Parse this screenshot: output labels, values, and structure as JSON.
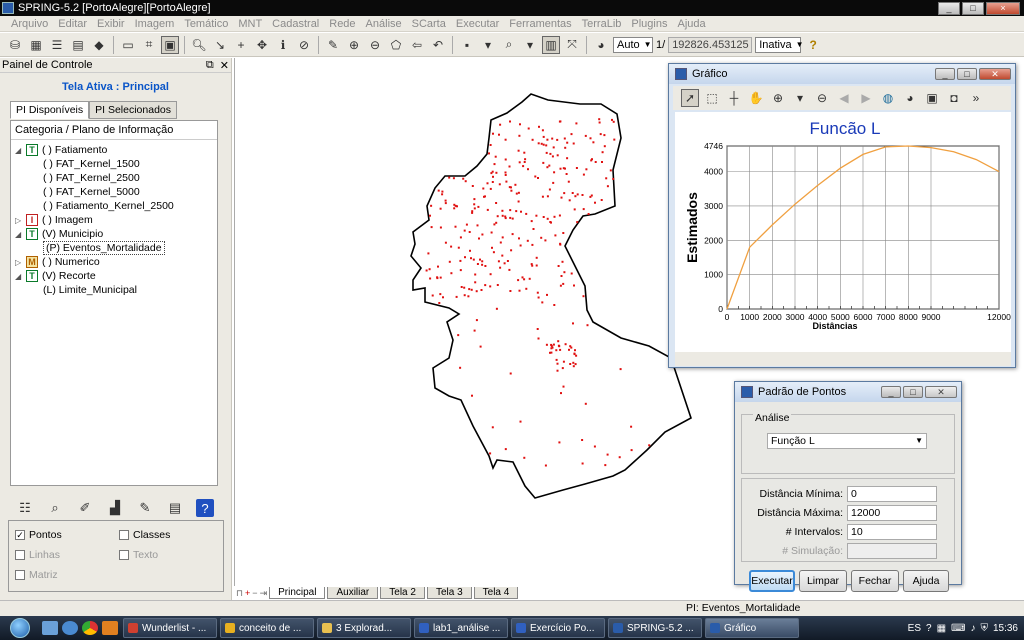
{
  "app": {
    "title": "SPRING-5.2 [PortoAlegre][PortoAlegre]",
    "window_buttons": [
      "_",
      "□",
      "×"
    ]
  },
  "menu": [
    {
      "label": "Arquivo",
      "enabled": false
    },
    {
      "label": "Editar",
      "enabled": false
    },
    {
      "label": "Exibir",
      "enabled": false
    },
    {
      "label": "Imagem",
      "enabled": false
    },
    {
      "label": "Temático",
      "enabled": false
    },
    {
      "label": "MNT",
      "enabled": false
    },
    {
      "label": "Cadastral",
      "enabled": false
    },
    {
      "label": "Rede",
      "enabled": false
    },
    {
      "label": "Análise",
      "enabled": false
    },
    {
      "label": "SCarta",
      "enabled": false
    },
    {
      "label": "Executar",
      "enabled": false
    },
    {
      "label": "Ferramentas",
      "enabled": false
    },
    {
      "label": "TerraLib",
      "enabled": false
    },
    {
      "label": "Plugins",
      "enabled": false
    },
    {
      "label": "Ajuda",
      "enabled": false
    }
  ],
  "toolbar": {
    "zoom_mode": "Auto",
    "scale_prefix": "1/",
    "scale_value": "192826.453125",
    "status_mode": "Inativa",
    "help_icon": "?"
  },
  "control_panel": {
    "title": "Painel de Controle",
    "active_screen": "Tela Ativa : Principal",
    "tabs": [
      "PI Disponíveis",
      "PI Selecionados"
    ],
    "tree_header": "Categoria / Plano de Informação",
    "tree": [
      {
        "expander": "◢",
        "badge": "T",
        "label": "( ) Fatiamento",
        "indent": 0
      },
      {
        "expander": "",
        "badge": "",
        "label": "( ) FAT_Kernel_1500",
        "indent": 1
      },
      {
        "expander": "",
        "badge": "",
        "label": "( ) FAT_Kernel_2500",
        "indent": 1
      },
      {
        "expander": "",
        "badge": "",
        "label": "( ) FAT_Kernel_5000",
        "indent": 1
      },
      {
        "expander": "",
        "badge": "",
        "label": "( ) Fatiamento_Kernel_2500",
        "indent": 1
      },
      {
        "expander": "▷",
        "badge": "I",
        "label": "( ) Imagem",
        "indent": 0
      },
      {
        "expander": "◢",
        "badge": "T",
        "label": "(V) Municipio",
        "indent": 0
      },
      {
        "expander": "",
        "badge": "",
        "label": "(P) Eventos_Mortalidade",
        "indent": 1,
        "selected": true
      },
      {
        "expander": "▷",
        "badge": "M",
        "label": "( ) Numerico",
        "indent": 0
      },
      {
        "expander": "◢",
        "badge": "T",
        "label": "(V) Recorte",
        "indent": 0
      },
      {
        "expander": "",
        "badge": "",
        "label": "(L) Limite_Municipal",
        "indent": 1
      }
    ],
    "checks": [
      {
        "label": "Pontos",
        "checked": true,
        "enabled": true
      },
      {
        "label": "Classes",
        "checked": false,
        "enabled": true
      },
      {
        "label": "Linhas",
        "checked": false,
        "enabled": false
      },
      {
        "label": "Texto",
        "checked": false,
        "enabled": false
      },
      {
        "label": "Matriz",
        "checked": false,
        "enabled": false
      }
    ]
  },
  "screen_tabs": [
    "Principal",
    "Auxiliar",
    "Tela 2",
    "Tela 3",
    "Tela 4"
  ],
  "status_text": "PI: Eventos_Mortalidade",
  "grafico": {
    "title": "Gráfico"
  },
  "chart_data": {
    "type": "line",
    "title": "Funcão L",
    "xlabel": "Distâncias",
    "ylabel": "Estimados",
    "xlim": [
      0,
      12000
    ],
    "ylim": [
      0,
      4746
    ],
    "x_ticks": [
      0,
      1000,
      2000,
      3000,
      4000,
      5000,
      6000,
      7000,
      8000,
      9000,
      12000
    ],
    "y_ticks": [
      0,
      1000,
      2000,
      3000,
      4000,
      4746
    ],
    "grid": true,
    "line_color": "#f0a040",
    "series": [
      {
        "x": [
          0,
          1000,
          2000,
          3000,
          4000,
          5000,
          6000,
          7000,
          8000,
          9000,
          10000,
          11000,
          12000
        ],
        "values": [
          0,
          1800,
          2450,
          3050,
          3600,
          4100,
          4500,
          4720,
          4746,
          4700,
          4580,
          4350,
          4000
        ]
      }
    ]
  },
  "padrao": {
    "title": "Padrão de Pontos",
    "group_label": "Análise",
    "analysis_value": "Função L",
    "fields": [
      {
        "label": "Distância Mínima:",
        "value": "0",
        "enabled": true
      },
      {
        "label": "Distância Máxima:",
        "value": "12000",
        "enabled": true
      },
      {
        "label": "# Intervalos:",
        "value": "10",
        "enabled": true
      },
      {
        "label": "# Simulação:",
        "value": "",
        "enabled": false
      }
    ],
    "buttons": [
      "Executar",
      "Limpar",
      "Fechar",
      "Ajuda"
    ]
  },
  "taskbar": {
    "tasks": [
      {
        "label": "Wunderlist - ...",
        "color": "#d04030"
      },
      {
        "label": "conceito de ...",
        "color": "#e8b020"
      },
      {
        "label": "3 Explorad...",
        "color": "#e8c050"
      },
      {
        "label": "lab1_análise ...",
        "color": "#3060c0"
      },
      {
        "label": "Exercício Po...",
        "color": "#3060c0"
      },
      {
        "label": "SPRING-5.2 ...",
        "color": "#2a5caa"
      },
      {
        "label": "Gráfico",
        "color": "#2a5caa",
        "active": true
      }
    ],
    "language": "ES",
    "clock": "15:36"
  }
}
